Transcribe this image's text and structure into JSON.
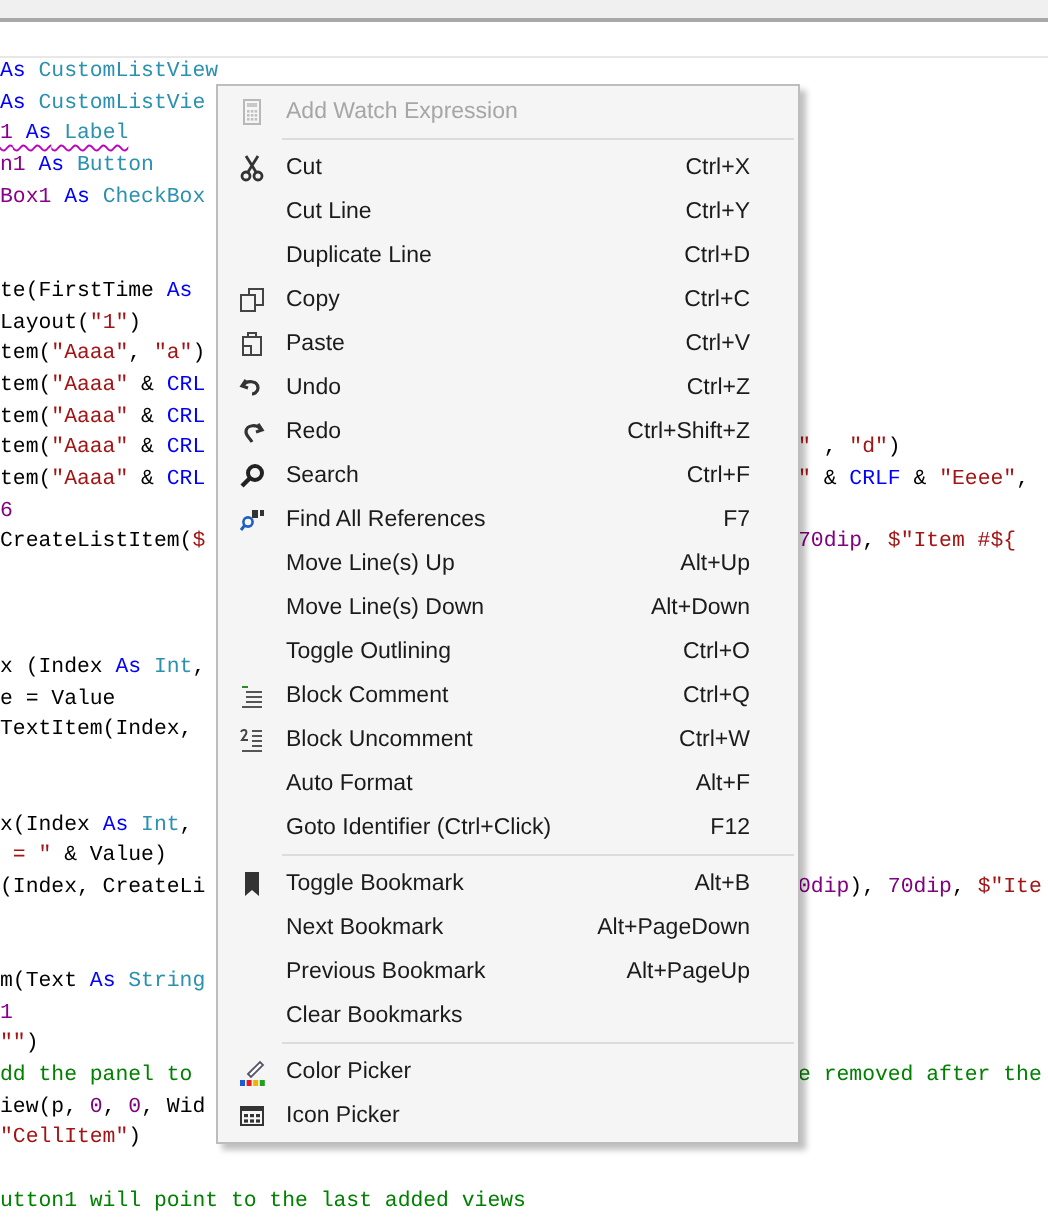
{
  "editor": {
    "lines": [
      {
        "kind": "code",
        "left": [
          {
            "text": "As",
            "kind": "keyword"
          },
          {
            "text": " CustomListView",
            "kind": "type"
          }
        ]
      },
      {
        "kind": "code",
        "left": [
          {
            "text": "As",
            "kind": "keyword"
          },
          {
            "text": " CustomListVie",
            "kind": "type"
          }
        ]
      },
      {
        "kind": "code",
        "squiggle": true,
        "left": [
          {
            "text": "1",
            "kind": "variable"
          },
          {
            "text": " As",
            "kind": "keyword"
          },
          {
            "text": " Label",
            "kind": "type"
          }
        ]
      },
      {
        "kind": "code",
        "left": [
          {
            "text": "n1",
            "kind": "variable"
          },
          {
            "text": " As",
            "kind": "keyword"
          },
          {
            "text": " Button",
            "kind": "type"
          }
        ]
      },
      {
        "kind": "code",
        "left": [
          {
            "text": "Box1",
            "kind": "variable"
          },
          {
            "text": " As",
            "kind": "keyword"
          },
          {
            "text": " CheckBox",
            "kind": "type"
          }
        ]
      },
      {
        "kind": "blank"
      },
      {
        "kind": "blank"
      },
      {
        "kind": "code",
        "left": [
          {
            "text": "te(FirstTime ",
            "kind": "plain"
          },
          {
            "text": "As",
            "kind": "keyword"
          }
        ]
      },
      {
        "kind": "code",
        "left": [
          {
            "text": "Layout(",
            "kind": "plain"
          },
          {
            "text": "\"1\"",
            "kind": "string"
          },
          {
            "text": ")",
            "kind": "plain"
          }
        ]
      },
      {
        "kind": "code",
        "left": [
          {
            "text": "tem(",
            "kind": "plain"
          },
          {
            "text": "\"Aaaa\"",
            "kind": "string"
          },
          {
            "text": ", ",
            "kind": "plain"
          },
          {
            "text": "\"a\"",
            "kind": "string"
          },
          {
            "text": ")",
            "kind": "plain"
          }
        ]
      },
      {
        "kind": "code",
        "left": [
          {
            "text": "tem(",
            "kind": "plain"
          },
          {
            "text": "\"Aaaa\"",
            "kind": "string"
          },
          {
            "text": " & ",
            "kind": "plain"
          },
          {
            "text": "CRL",
            "kind": "keyword"
          }
        ]
      },
      {
        "kind": "code",
        "left": [
          {
            "text": "tem(",
            "kind": "plain"
          },
          {
            "text": "\"Aaaa\"",
            "kind": "string"
          },
          {
            "text": " & ",
            "kind": "plain"
          },
          {
            "text": "CRL",
            "kind": "keyword"
          }
        ]
      },
      {
        "kind": "code",
        "left": [
          {
            "text": "tem(",
            "kind": "plain"
          },
          {
            "text": "\"Aaaa\"",
            "kind": "string"
          },
          {
            "text": " & ",
            "kind": "plain"
          },
          {
            "text": "CRL",
            "kind": "keyword"
          }
        ],
        "right": [
          {
            "text": "\"",
            "kind": "string"
          },
          {
            "text": " , ",
            "kind": "plain"
          },
          {
            "text": "\"d\"",
            "kind": "string"
          },
          {
            "text": ")",
            "kind": "plain"
          }
        ]
      },
      {
        "kind": "code",
        "left": [
          {
            "text": "tem(",
            "kind": "plain"
          },
          {
            "text": "\"Aaaa\"",
            "kind": "string"
          },
          {
            "text": " & ",
            "kind": "plain"
          },
          {
            "text": "CRL",
            "kind": "keyword"
          }
        ],
        "right": [
          {
            "text": "\"",
            "kind": "string"
          },
          {
            "text": " & ",
            "kind": "plain"
          },
          {
            "text": "CRLF",
            "kind": "keyword"
          },
          {
            "text": " & ",
            "kind": "plain"
          },
          {
            "text": "\"Eeee\"",
            "kind": "string"
          },
          {
            "text": ",",
            "kind": "plain"
          }
        ]
      },
      {
        "kind": "code",
        "left": [
          {
            "text": "6",
            "kind": "number"
          }
        ]
      },
      {
        "kind": "code",
        "left": [
          {
            "text": "CreateListItem(",
            "kind": "plain"
          },
          {
            "text": "$",
            "kind": "string"
          }
        ],
        "right": [
          {
            "text": "70dip",
            "kind": "number"
          },
          {
            "text": ", ",
            "kind": "plain"
          },
          {
            "text": "$\"Item #${",
            "kind": "string"
          }
        ]
      },
      {
        "kind": "blank"
      },
      {
        "kind": "blank"
      },
      {
        "kind": "blank"
      },
      {
        "kind": "code",
        "left": [
          {
            "text": "x (Index ",
            "kind": "plain"
          },
          {
            "text": "As",
            "kind": "keyword"
          },
          {
            "text": " Int",
            "kind": "type"
          },
          {
            "text": ",",
            "kind": "plain"
          }
        ]
      },
      {
        "kind": "code",
        "left": [
          {
            "text": "e = Value",
            "kind": "plain"
          }
        ]
      },
      {
        "kind": "code",
        "left": [
          {
            "text": "TextItem(Index,",
            "kind": "plain"
          }
        ]
      },
      {
        "kind": "blank"
      },
      {
        "kind": "blank"
      },
      {
        "kind": "code",
        "left": [
          {
            "text": "x(Index ",
            "kind": "plain"
          },
          {
            "text": "As",
            "kind": "keyword"
          },
          {
            "text": " Int",
            "kind": "type"
          },
          {
            "text": ",",
            "kind": "plain"
          }
        ]
      },
      {
        "kind": "code",
        "left": [
          {
            "text": " = \"",
            "kind": "string"
          },
          {
            "text": " & Value)",
            "kind": "plain"
          }
        ]
      },
      {
        "kind": "code",
        "left": [
          {
            "text": "(Index, CreateLi",
            "kind": "plain"
          }
        ],
        "right": [
          {
            "text": "0dip",
            "kind": "number"
          },
          {
            "text": "), ",
            "kind": "plain"
          },
          {
            "text": "70dip",
            "kind": "number"
          },
          {
            "text": ", ",
            "kind": "plain"
          },
          {
            "text": "$\"Ite",
            "kind": "string"
          }
        ]
      },
      {
        "kind": "blank"
      },
      {
        "kind": "blank"
      },
      {
        "kind": "code",
        "left": [
          {
            "text": "m(Text ",
            "kind": "plain"
          },
          {
            "text": "As",
            "kind": "keyword"
          },
          {
            "text": " String",
            "kind": "type"
          }
        ]
      },
      {
        "kind": "code",
        "left": [
          {
            "text": "1",
            "kind": "variable"
          }
        ]
      },
      {
        "kind": "code",
        "left": [
          {
            "text": "\"\"",
            "kind": "string"
          },
          {
            "text": ")",
            "kind": "plain"
          }
        ]
      },
      {
        "kind": "code",
        "left": [
          {
            "text": "dd the panel to",
            "kind": "comment"
          }
        ],
        "right": [
          {
            "text": "e removed after the",
            "kind": "comment"
          }
        ]
      },
      {
        "kind": "code",
        "left": [
          {
            "text": "iew(p, ",
            "kind": "plain"
          },
          {
            "text": "0",
            "kind": "number"
          },
          {
            "text": ", ",
            "kind": "plain"
          },
          {
            "text": "0",
            "kind": "number"
          },
          {
            "text": ", Wid",
            "kind": "plain"
          }
        ]
      },
      {
        "kind": "code",
        "left": [
          {
            "text": "\"CellItem\"",
            "kind": "string"
          },
          {
            "text": ")",
            "kind": "plain"
          }
        ]
      },
      {
        "kind": "blank"
      },
      {
        "kind": "code",
        "left": [
          {
            "text": "utton1 will point to the last added views",
            "kind": "comment"
          }
        ]
      }
    ]
  },
  "context_menu": {
    "items": [
      {
        "kind": "item",
        "label": "Add Watch Expression",
        "disabled": true
      },
      {
        "kind": "separator"
      },
      {
        "kind": "item",
        "label": "Cut",
        "shortcut": "Ctrl+X",
        "disabled": false
      },
      {
        "kind": "item",
        "label": "Cut Line",
        "shortcut": "Ctrl+Y",
        "disabled": false
      },
      {
        "kind": "item",
        "label": "Duplicate Line",
        "shortcut": "Ctrl+D",
        "disabled": false
      },
      {
        "kind": "item",
        "label": "Copy",
        "shortcut": "Ctrl+C",
        "disabled": false
      },
      {
        "kind": "item",
        "label": "Paste",
        "shortcut": "Ctrl+V",
        "disabled": false
      },
      {
        "kind": "item",
        "label": "Undo",
        "shortcut": "Ctrl+Z",
        "disabled": false
      },
      {
        "kind": "item",
        "label": "Redo",
        "shortcut": "Ctrl+Shift+Z",
        "disabled": false
      },
      {
        "kind": "item",
        "label": "Search",
        "shortcut": "Ctrl+F",
        "disabled": false
      },
      {
        "kind": "item",
        "label": "Find All References",
        "shortcut": "F7",
        "disabled": false
      },
      {
        "kind": "item",
        "label": "Move Line(s) Up",
        "shortcut": "Alt+Up",
        "disabled": false
      },
      {
        "kind": "item",
        "label": "Move Line(s) Down",
        "shortcut": "Alt+Down",
        "disabled": false
      },
      {
        "kind": "item",
        "label": "Toggle Outlining",
        "shortcut": "Ctrl+O",
        "disabled": false
      },
      {
        "kind": "item",
        "label": "Block Comment",
        "shortcut": "Ctrl+Q",
        "disabled": false
      },
      {
        "kind": "item",
        "label": "Block Uncomment",
        "shortcut": "Ctrl+W",
        "disabled": false
      },
      {
        "kind": "item",
        "label": "Auto Format",
        "shortcut": "Alt+F",
        "disabled": false
      },
      {
        "kind": "item",
        "label": "Goto Identifier (Ctrl+Click)",
        "shortcut": "F12",
        "disabled": false
      },
      {
        "kind": "separator"
      },
      {
        "kind": "item",
        "label": "Toggle Bookmark",
        "shortcut": "Alt+B",
        "disabled": false
      },
      {
        "kind": "item",
        "label": "Next Bookmark",
        "shortcut": "Alt+PageDown",
        "disabled": false
      },
      {
        "kind": "item",
        "label": "Previous Bookmark",
        "shortcut": "Alt+PageUp",
        "disabled": false
      },
      {
        "kind": "item",
        "label": "Clear Bookmarks",
        "disabled": false
      },
      {
        "kind": "separator"
      },
      {
        "kind": "item",
        "label": "Color Picker",
        "disabled": false
      },
      {
        "kind": "item",
        "label": "Icon Picker",
        "disabled": false
      }
    ]
  }
}
